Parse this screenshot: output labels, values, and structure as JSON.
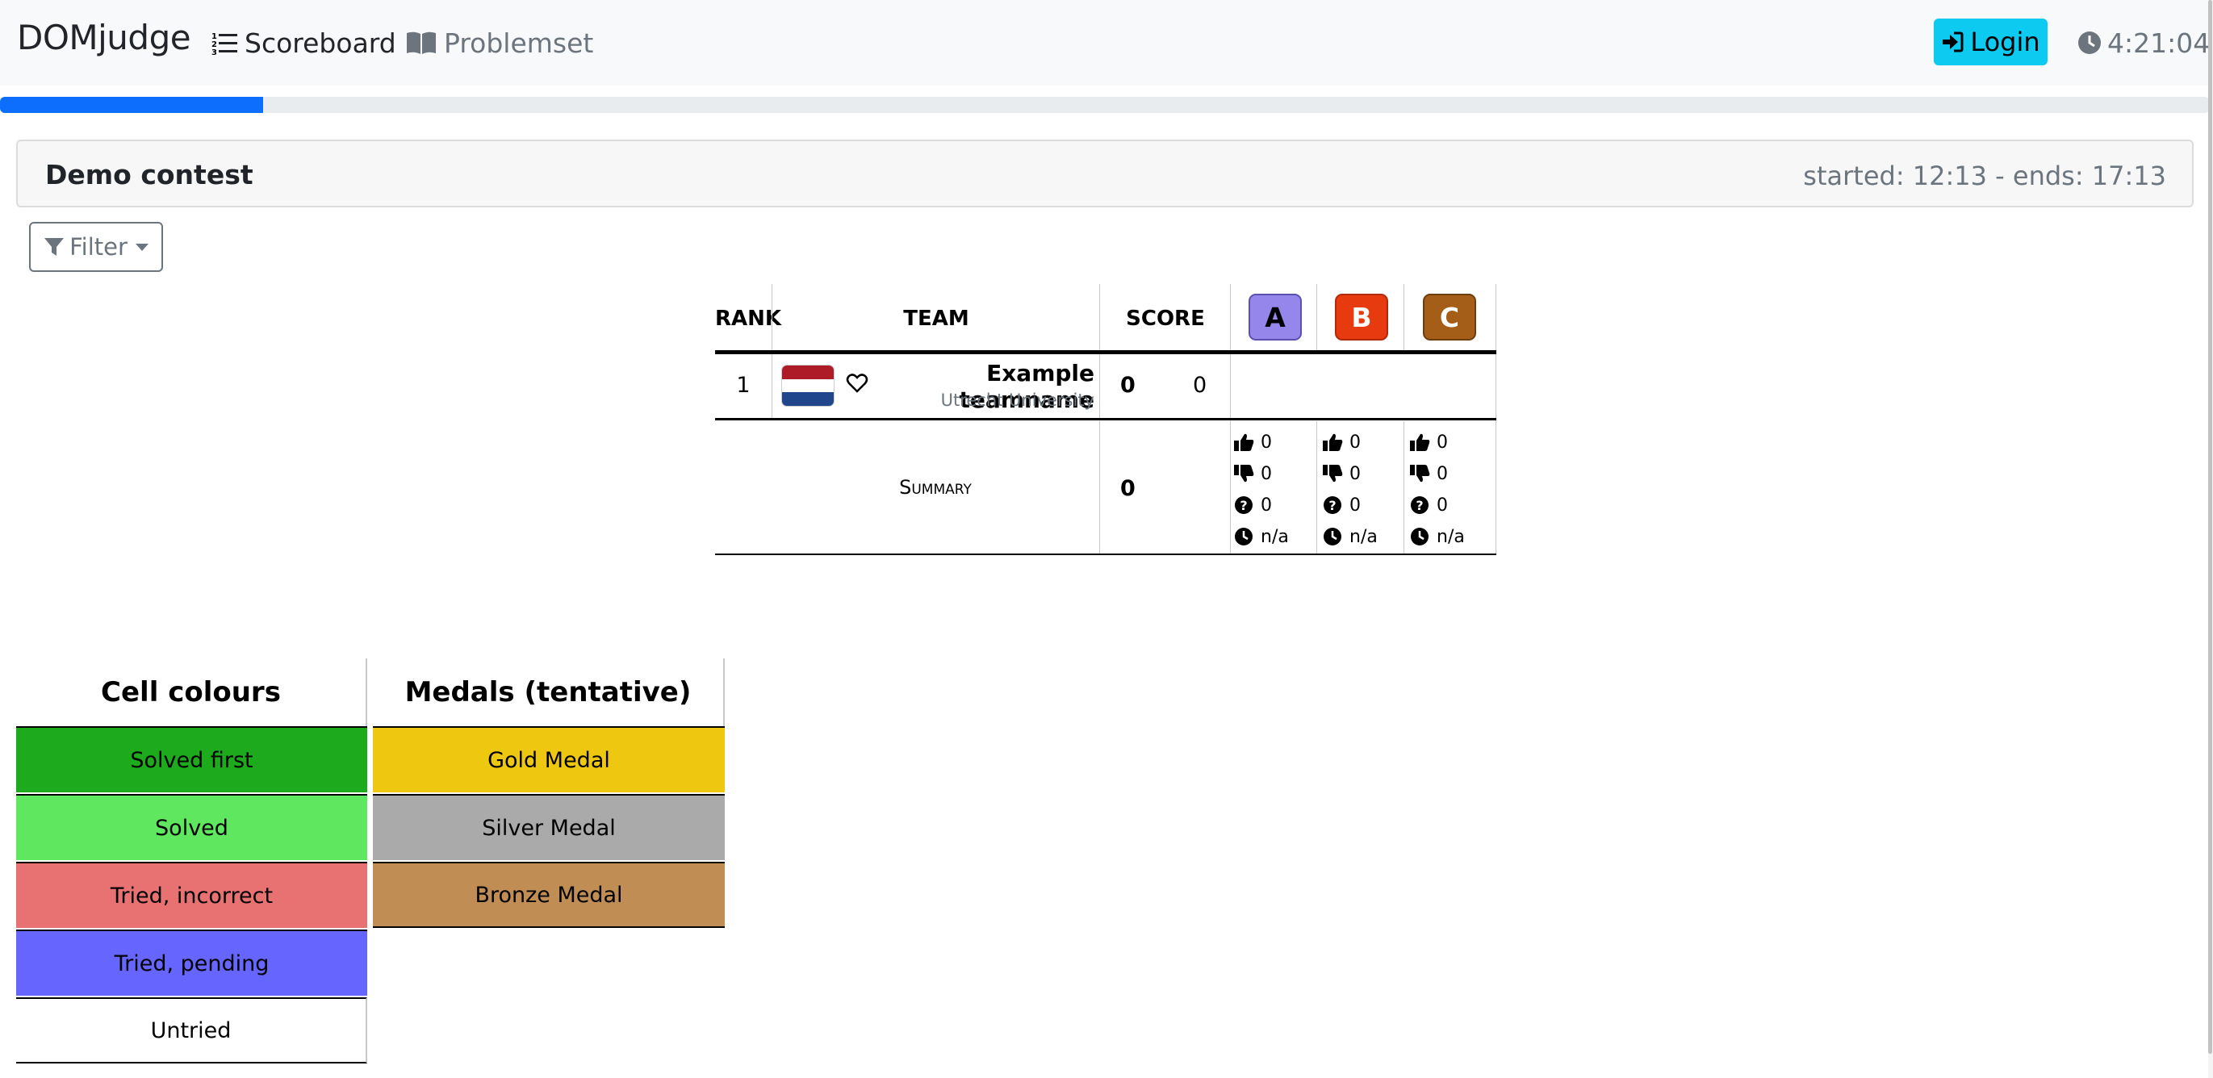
{
  "navbar": {
    "brand": "DOMjudge",
    "links": [
      {
        "label": "Scoreboard",
        "icon": "list-ordered-icon"
      },
      {
        "label": "Problemset",
        "icon": "book-open-icon"
      }
    ],
    "login_label": "Login",
    "clock": "4:21:04"
  },
  "progress": {
    "fraction": 0.119,
    "color": "#0d6efd"
  },
  "contest": {
    "name": "Demo contest",
    "time_info": "started: 12:13 - ends: 17:13"
  },
  "filter": {
    "label": "Filter"
  },
  "scoreboard": {
    "headers": {
      "rank": "RANK",
      "team": "TEAM",
      "score": "SCORE"
    },
    "problems": [
      {
        "label": "A",
        "bg": "#9486ea",
        "border": "#5b4fb0",
        "text": "#000000"
      },
      {
        "label": "B",
        "bg": "#e83a0f",
        "border": "#b02a08",
        "text": "#ffffff"
      },
      {
        "label": "C",
        "bg": "#a45e18",
        "border": "#6e3d0c",
        "text": "#ffffff"
      }
    ],
    "teams": [
      {
        "rank": "1",
        "name": "Example teamname",
        "affiliation": "Utrecht University",
        "flag_colors": [
          "#ae1c28",
          "#ffffff",
          "#21468b"
        ],
        "solved": "0",
        "penalty": "0"
      }
    ],
    "summary": {
      "label": "Summary",
      "score": "0",
      "problems": [
        {
          "correct": "0",
          "incorrect": "0",
          "pending": "0",
          "first": "n/a"
        },
        {
          "correct": "0",
          "incorrect": "0",
          "pending": "0",
          "first": "n/a"
        },
        {
          "correct": "0",
          "incorrect": "0",
          "pending": "0",
          "first": "n/a"
        }
      ]
    }
  },
  "legends": {
    "cell_colours": {
      "title": "Cell colours",
      "items": [
        {
          "label": "Solved first",
          "color": "#1daa1d"
        },
        {
          "label": "Solved",
          "color": "#60e760"
        },
        {
          "label": "Tried, incorrect",
          "color": "#e87272"
        },
        {
          "label": "Tried, pending",
          "color": "#6666ff"
        },
        {
          "label": "Untried",
          "color": "#ffffff"
        }
      ]
    },
    "medals": {
      "title": "Medals (tentative)",
      "items": [
        {
          "label": "Gold Medal",
          "color": "#eec710"
        },
        {
          "label": "Silver Medal",
          "color": "#aaaaaa"
        },
        {
          "label": "Bronze Medal",
          "color": "#c08e55"
        }
      ]
    }
  }
}
